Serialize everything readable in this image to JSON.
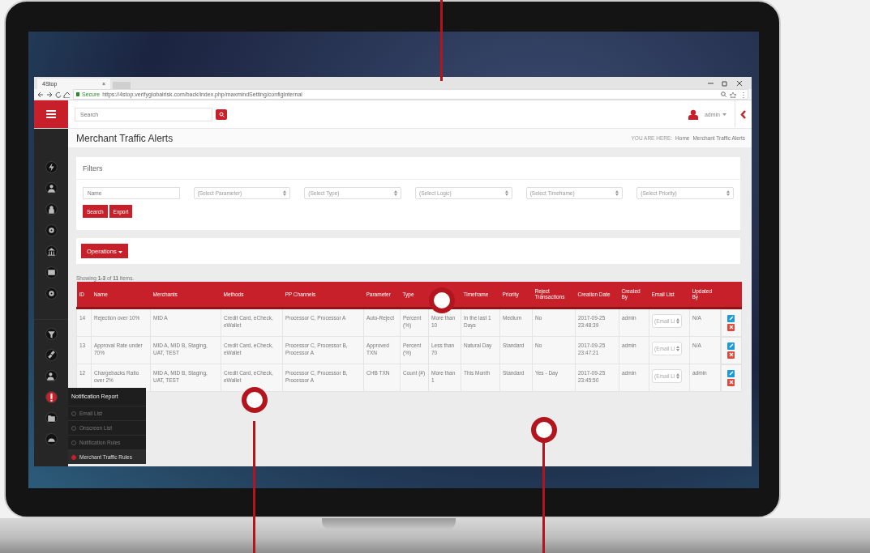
{
  "browser": {
    "tab_title": "4Stop",
    "tab_close": "×",
    "secure": "Secure",
    "url": "https://4stop.verifyglobalrisk.com/back/index.php/maxmindSetting/configInternal"
  },
  "header": {
    "search_placeholder": "Search",
    "user": "admin"
  },
  "page_title": "Merchant Traffic Alerts",
  "breadcrumb": {
    "label": "YOU ARE HERE:",
    "items": [
      "Home",
      "Merchant Traffic Alerts"
    ]
  },
  "filters": {
    "title": "Filters",
    "name_placeholder": "Name",
    "selects": [
      "(Select Parameter)",
      "(Select Type)",
      "(Select Logic)",
      "(Select Timeframe)",
      "(Select Priority)"
    ],
    "buttons": [
      "Search",
      "Export"
    ]
  },
  "operations": "Operations",
  "summary": "Showing **1-3** of **11** items.",
  "table": {
    "columns": [
      {
        "label": "ID"
      },
      {
        "label": "Name"
      },
      {
        "label": "Merchants"
      },
      {
        "label": "Methods"
      },
      {
        "label": "PP Channels"
      },
      {
        "label": "Parameter"
      },
      {
        "label": "Type"
      },
      {},
      {
        "label": "Timeframe"
      },
      {
        "label": "Priority"
      },
      {
        "label": "Reject Transactions"
      },
      {
        "label": "Creation Date"
      },
      {
        "label": "Created By"
      },
      {
        "label": "Email List"
      },
      {
        "label": "Updated By"
      }
    ],
    "rows": [
      {
        "cells": [
          "14",
          "Rejection over 10%",
          "MID A",
          "Credit Card, eCheck, eWallet",
          "Processor C, Processor A",
          "Auto-Reject",
          "Percent (%)",
          "More than 10",
          "In the last 1 Days",
          "Medium",
          "No",
          "2017-09-25 23:48:39",
          "admin"
        ],
        "email_placeholder": "(Email Li",
        "updated_by": "N/A"
      },
      {
        "cells": [
          "13",
          "Approval Rate under 70%",
          "MID A, MID B, Staging, UAT, TEST",
          "Credit Card, eCheck, eWallet",
          "Processor C, Processor B, Processor A",
          "Approved TXN",
          "Percent (%)",
          "Less than 70",
          "Natural Day",
          "Standard",
          "No",
          "2017-09-25 23:47:21",
          "admin"
        ],
        "email_placeholder": "(Email Li",
        "updated_by": "N/A"
      },
      {
        "cells": [
          "12",
          "Chargebacks Ratio over 2%",
          "MID A, MID B, Staging, UAT, TEST",
          "Credit Card, eCheck, eWallet",
          "Processor C, Processor B, Processor A",
          "CHB TXN",
          "Count (#)",
          "More than 1",
          "This Month",
          "Standard",
          "Yes - Day",
          "2017-09-25 23:45:50",
          "admin"
        ],
        "email_placeholder": "(Email Li",
        "updated_by": "admin"
      }
    ]
  },
  "sidebar": {
    "top_icons": [
      {
        "selected": false
      },
      {
        "selected": false
      },
      {
        "selected": false
      },
      {
        "selected": false
      },
      {
        "selected": false
      },
      {
        "selected": false
      },
      {
        "selected": false
      }
    ],
    "bottom_icons": [
      {
        "selected": false
      },
      {
        "selected": false
      },
      {
        "selected": false
      },
      {
        "selected": true
      },
      {
        "selected": false
      },
      {
        "selected": false
      }
    ],
    "flyout": {
      "title": "Notification Report",
      "items": [
        {
          "label": "Email List",
          "selected": false
        },
        {
          "label": "Onscreen List",
          "selected": false
        },
        {
          "label": "Notification Rules",
          "selected": false
        },
        {
          "label": "Merchant Traffic Rules",
          "selected": true
        }
      ]
    }
  }
}
